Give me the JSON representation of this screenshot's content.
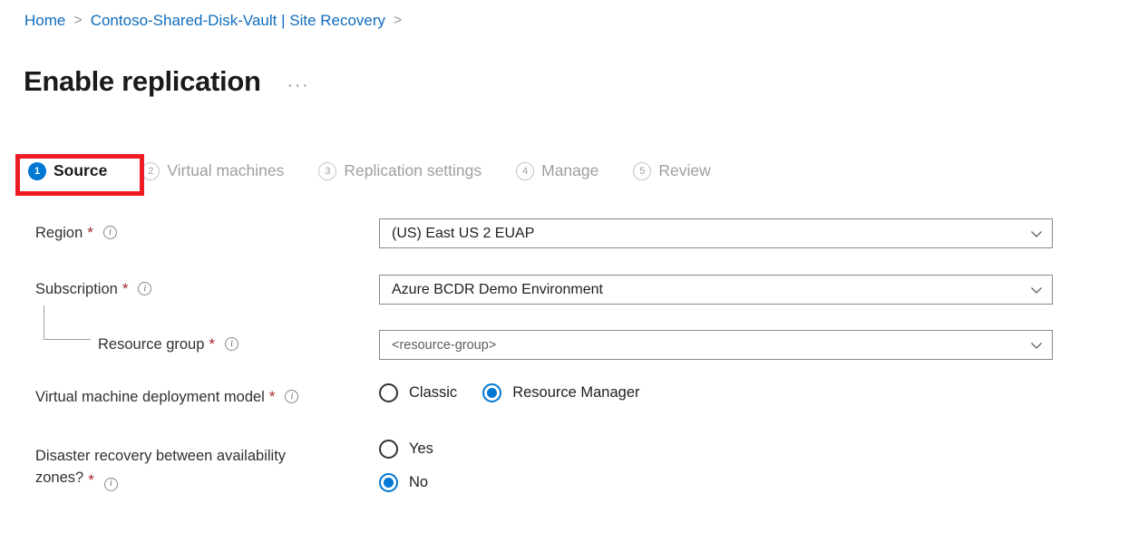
{
  "breadcrumb": {
    "separator": ">",
    "items": [
      {
        "label": "Home"
      },
      {
        "label": "Contoso-Shared-Disk-Vault | Site Recovery"
      }
    ],
    "trailing_separator": ">"
  },
  "header": {
    "title": "Enable replication",
    "more_label": "···"
  },
  "wizard": {
    "tabs": [
      {
        "number": "1",
        "label": "Source",
        "state": "active"
      },
      {
        "number": "2",
        "label": "Virtual machines",
        "state": "inactive"
      },
      {
        "number": "3",
        "label": "Replication settings",
        "state": "inactive"
      },
      {
        "number": "4",
        "label": "Manage",
        "state": "inactive"
      },
      {
        "number": "5",
        "label": "Review",
        "state": "inactive"
      }
    ]
  },
  "annotation": {
    "color": "#ed1c24",
    "target": "Source"
  },
  "form": {
    "region": {
      "label": "Region",
      "required_mark": "*",
      "info": "i",
      "value": "(US) East US 2 EUAP"
    },
    "subscription": {
      "label": "Subscription",
      "required_mark": "*",
      "info": "i",
      "value": "Azure BCDR Demo Environment"
    },
    "resource_group": {
      "label": "Resource group",
      "required_mark": "*",
      "info": "i",
      "placeholder": "<resource-group>",
      "value": "<resource-group>"
    },
    "deployment_model": {
      "label": "Virtual machine deployment model",
      "required_mark": "*",
      "info": "i",
      "options": [
        {
          "label": "Classic",
          "selected": false
        },
        {
          "label": "Resource Manager",
          "selected": true
        }
      ]
    },
    "availability_zones": {
      "label_line1": "Disaster recovery between availability",
      "label_line2": "zones?",
      "required_mark": "*",
      "info": "i",
      "options": [
        {
          "label": "Yes",
          "selected": false
        },
        {
          "label": "No",
          "selected": true
        }
      ]
    }
  },
  "colors": {
    "accent": "#0078d4",
    "link": "#0f6cbd",
    "required": "#a4262c",
    "annotation": "#ed1c24"
  }
}
